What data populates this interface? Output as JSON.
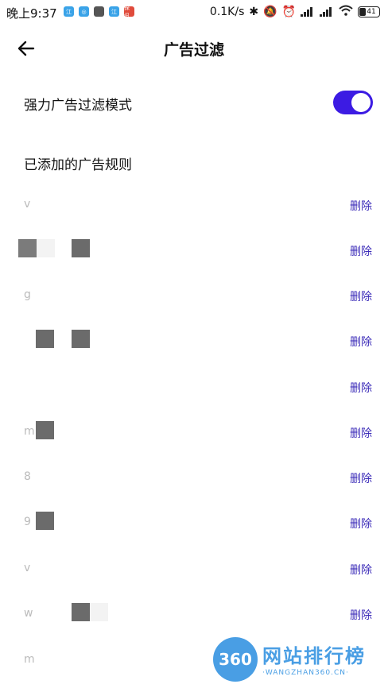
{
  "status_bar": {
    "time": "晚上9:37",
    "apps": [
      {
        "name": "app-icon",
        "label": "江",
        "color": "#3aa3e8"
      },
      {
        "name": "app-icon",
        "label": "◎",
        "color": "#3aa3e8"
      },
      {
        "name": "app-icon",
        "label": "",
        "color": "#555555"
      },
      {
        "name": "app-icon",
        "label": "江",
        "color": "#3aa3e8"
      },
      {
        "name": "app-icon",
        "label": "探讯",
        "color": "#e04b3b"
      }
    ],
    "speed": "0.1K/s",
    "battery": "41"
  },
  "appbar": {
    "title": "广告过滤"
  },
  "toggle": {
    "label": "强力广告过滤模式",
    "on": true,
    "accent": "#3c1be3"
  },
  "section_title": "已添加的广告规则",
  "delete_label": "删除",
  "rules": [
    "v",
    "",
    "g",
    "",
    "",
    "m",
    "8",
    "9",
    "v",
    "w",
    "m"
  ],
  "watermark": {
    "logo": "360",
    "cn": "网站排行榜",
    "en": "·WANGZHAN360.CN·"
  }
}
